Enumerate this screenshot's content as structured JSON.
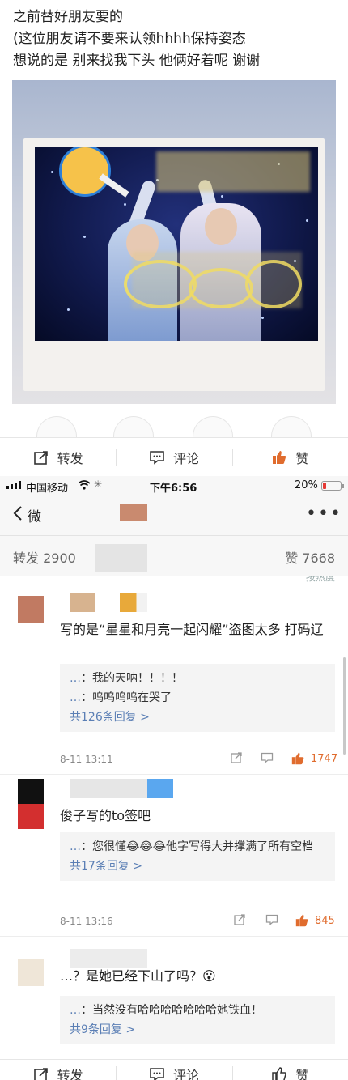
{
  "post": {
    "lines": [
      "之前替好朋友要的",
      "(这位朋友请不要来认领hhhh保持姿态",
      "想说的是 别来找我下头 他俩好着呢 谢谢"
    ]
  },
  "action_bar": {
    "repost_label": "转发",
    "comment_label": "评论",
    "like_label": "赞"
  },
  "status_bar": {
    "carrier": "中国移动",
    "time": "下午6:56",
    "battery_text": "20%",
    "battery_level": 0.2
  },
  "nav": {
    "back_label": "微",
    "more_label": "•••"
  },
  "counts": {
    "repost": "转发 2900",
    "like": "赞 7668",
    "sort_hint": "按热度"
  },
  "comments": [
    {
      "text": "写的是“星星和月亮一起闪耀”盗图太多 打码辽",
      "replies": [
        {
          "name": "…",
          "text": "：我的天呐！！！！"
        },
        {
          "name": "…",
          "text": "：呜呜呜呜在哭了"
        }
      ],
      "more_replies": "共126条回复 >",
      "date": "8-11 13:11",
      "likes": "1747"
    },
    {
      "text": "俊子写的to签吧",
      "replies": [
        {
          "name": "…",
          "text": "：您很懂😂😂😂他字写得大并撑满了所有空档"
        }
      ],
      "more_replies": "共17条回复 >",
      "date": "8-11 13:16",
      "likes": "845"
    },
    {
      "text": "…？是她已经下山了吗？😮",
      "replies": [
        {
          "name": "…",
          "text": "：当然没有哈哈哈哈哈哈哈她铁血！"
        }
      ],
      "more_replies": "共9条回复 >"
    }
  ],
  "colors": {
    "accent_orange": "#e06c2e",
    "link_blue": "#5b7fb5",
    "battery_red": "#e53935"
  }
}
